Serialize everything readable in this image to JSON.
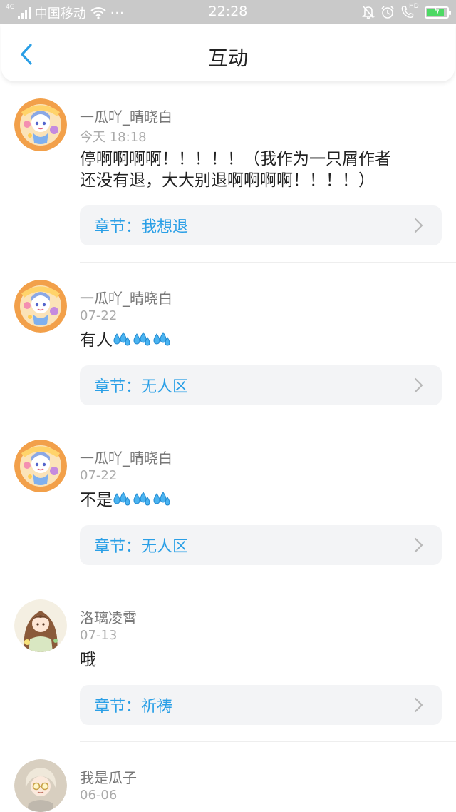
{
  "status_bar": {
    "network": "4G",
    "carrier": "中国移动",
    "time": "22:28",
    "hd_label": "HD",
    "battery_level": 0.85,
    "battery_color": "#4cd964"
  },
  "header": {
    "title": "互动",
    "back_icon": "chevron-left-icon",
    "accent": "#2a9fe6"
  },
  "chapter_prefix": "章节：",
  "comments": [
    {
      "user": "一瓜吖_晴晓白",
      "time": "今天 18:18",
      "content": "停啊啊啊啊！！！！！（我作为一只屑作者还没有退，大大别退啊啊啊啊！！！！）",
      "content_lines": [
        "停啊啊啊啊！！！！！（我作为一只屑作者",
        "还没有退，大大别退啊啊啊啊！！！！）"
      ],
      "emoji_count": 0,
      "chapter": "我想退"
    },
    {
      "user": "一瓜吖_晴晓白",
      "time": "07-22",
      "content": "有人",
      "content_lines": [
        "有人"
      ],
      "emoji_count": 3,
      "chapter": "无人区"
    },
    {
      "user": "一瓜吖_晴晓白",
      "time": "07-22",
      "content": "不是",
      "content_lines": [
        "不是"
      ],
      "emoji_count": 3,
      "chapter": "无人区"
    },
    {
      "user": "洛璃凌霄",
      "time": "07-13",
      "content": "哦",
      "content_lines": [
        "哦"
      ],
      "emoji_count": 0,
      "chapter": "祈祷"
    },
    {
      "user": "我是瓜子",
      "time": "06-06",
      "content": "",
      "content_lines": [],
      "emoji_count": 0,
      "chapter": ""
    }
  ]
}
